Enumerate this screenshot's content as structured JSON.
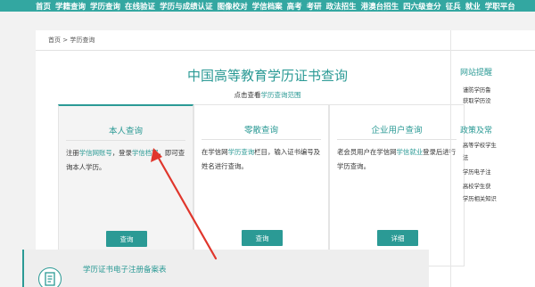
{
  "topnav": {
    "items": [
      "首页",
      "学籍查询",
      "学历查询",
      "在线验证",
      "学历与成绩认证",
      "图像校对",
      "学信档案",
      "高考",
      "考研",
      "政法招生",
      "港澳台招生",
      "四六级查分",
      "征兵",
      "就业",
      "学职平台"
    ]
  },
  "breadcrumb": {
    "home": "首页",
    "sep": ">",
    "current": "学历查询"
  },
  "main": {
    "title": "中国高等教育学历证书查询",
    "sub_prefix": "点击查看",
    "sub_link": "学历查询范围"
  },
  "cards": [
    {
      "title": "本人查询",
      "t1": "注册",
      "l1": "学信网账号",
      "t2": "，登录",
      "l2": "学信档案",
      "t3": "，即可查询本人学历。",
      "button": "查询"
    },
    {
      "title": "零散查询",
      "t1": "在学信网",
      "l1": "学历查询",
      "t2": "栏目，输入证书编号及姓名进行查询。",
      "button": "查询"
    },
    {
      "title": "企业用户查询",
      "t1": "老会员用户在学信网",
      "l1": "学信就业",
      "t2": "登录后进行学历查询。",
      "button": "详细"
    }
  ],
  "registration": {
    "title": "学历证书电子注册备案表"
  },
  "sidebar": {
    "head1": "网站提醒",
    "items1": [
      "谨防学历鲁",
      "获取学历没"
    ],
    "head2": "政策及常",
    "items2": [
      "高等学校学生",
      "法",
      "学历电子注",
      "高校学生获",
      "学历相关知识"
    ]
  },
  "colors": {
    "accent": "#2b9a95",
    "topnav": "#33a7a1",
    "arrow": "#e0362c"
  },
  "icons": {
    "registration": "document-icon",
    "annotation": "red-arrow"
  }
}
